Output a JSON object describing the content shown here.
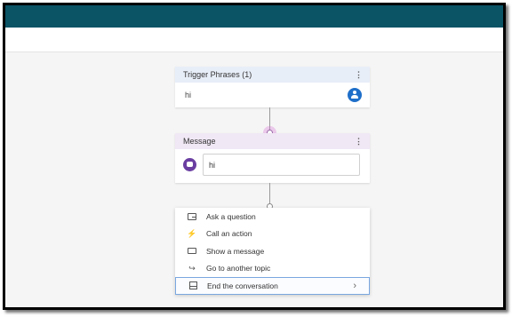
{
  "trigger_card": {
    "title": "Trigger Phrases (1)",
    "menu_glyph": "⋮",
    "phrase": "hi",
    "icon": "person-icon"
  },
  "message_card": {
    "title": "Message",
    "menu_glyph": "⋮",
    "text": "hi",
    "icon": "bot-icon"
  },
  "add_node_menu": {
    "items": [
      {
        "label": "Ask a question",
        "icon": "question-icon"
      },
      {
        "label": "Call an action",
        "icon": "lightning-icon",
        "glyph": "⚡"
      },
      {
        "label": "Show a message",
        "icon": "message-icon"
      },
      {
        "label": "Go to another topic",
        "icon": "redirect-icon",
        "glyph": "↪"
      },
      {
        "label": "End the conversation",
        "icon": "end-icon",
        "chevron": "›"
      }
    ]
  },
  "colors": {
    "topbar": "#0b5466",
    "trigger_header": "#e8eef8",
    "message_header": "#f0e8f5",
    "accent_blue": "#1f6fc9",
    "bot_purple": "#6a3ea1"
  }
}
